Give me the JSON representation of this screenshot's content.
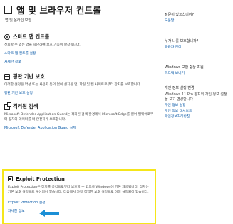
{
  "page": {
    "title": "앱 및 브라우저 컨트롤",
    "subtitle": "앱 및 온라인 보안."
  },
  "sections": {
    "smart_app": {
      "icon": "app-control-icon",
      "title": "스마트 앱 컨트롤",
      "desc": "신뢰할 수 없는 앱을 차단하여 보호 기능이 향상됩니다.",
      "link1": "스마트 앱 컨트롤 설정",
      "link2": "자세한 정보"
    },
    "reputation": {
      "icon": "browser-shield-icon",
      "title": "평판 기반 보호",
      "desc": "이러한 설정은 악성 또는 사용자 동의 없이 설치된 앱, 파일 및 웹 사이트로부터 장치를 보호합니다.",
      "link1": "평판 기반 보호 설정"
    },
    "isolation": {
      "icon": "isolated-browsing-icon",
      "title": "격리된 검색",
      "desc": "Microsoft Defender Application Guard는 격리된 검색 환경에서 Microsoft Edge를 열어 맬웨어로부터 장치와 데이터를 더 안전하게 보호합니다.",
      "link1": "Microsoft Defender Application Guard 설치"
    },
    "exploit": {
      "icon": "exploit-protection-icon",
      "title": "Exploit Protection",
      "desc": "Exploit Protection은 장치를 공격으로부터 보호할 수 있도록 Windows에 기본 제공됩니다. 장치는 기본 보호 설정으로 구성되어 있습니다. 다음에서 가장 적합한 보호 설정으로 이미 설정되어 있습니다.",
      "link1": "Exploit Protection 설정",
      "link2": "자세한 정보"
    }
  },
  "sidebar": {
    "blocks": [
      {
        "label": "질문이 있으십니까?",
        "links": [
          "도움말"
        ]
      },
      {
        "label": "누가 나를 보호합니까?",
        "links": [
          "공급자 관리"
        ]
      },
      {
        "label": "Windows 보안 향상 지원",
        "links": [
          "피드백 보내기"
        ]
      },
      {
        "label": "개인 정보 설정 변경",
        "desc": "Windows 11 Pro 장치의 개인 정보 설정을 보고 변경합니다.",
        "links": [
          "개인 정보 설정",
          "개인 정보 대시보드",
          "개인정보처리방침"
        ]
      }
    ]
  },
  "colors": {
    "highlight": "#f5e61a",
    "link": "#0a5aa8",
    "arrow": "#1b8fd6"
  }
}
